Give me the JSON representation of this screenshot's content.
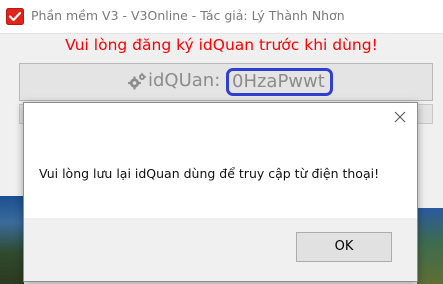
{
  "window": {
    "title": "Phần mềm V3 - V3Online - Tác giả: Lý Thành Nhơn"
  },
  "main": {
    "warning": "Vui lòng đăng ký idQuan trước khi dùng!",
    "idquan_label": "idQUan:",
    "idquan_value": "0HzaPwwt"
  },
  "dialog": {
    "message": "Vui lòng lưu lại idQuan dùng để truy cập từ điện thoại!",
    "ok_label": "OK"
  },
  "colors": {
    "warning_text": "#ff0000",
    "highlight_border": "#2f3fd2",
    "app_icon": "#e2231a"
  },
  "icons": [
    "app-icon",
    "gear-icon",
    "close-icon"
  ]
}
